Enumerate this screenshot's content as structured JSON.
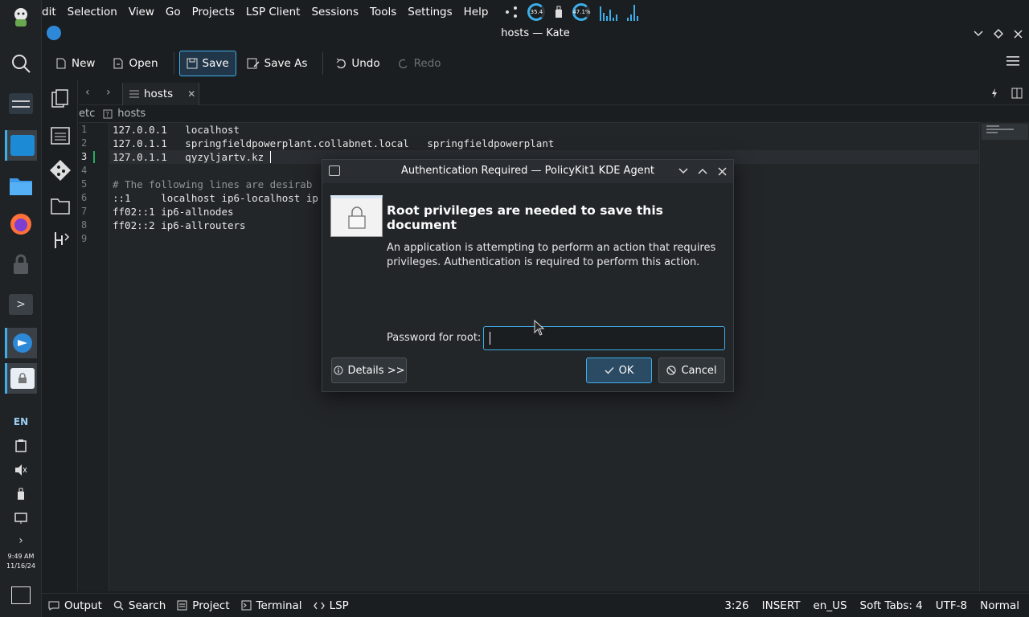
{
  "colors": {
    "accent": "#3daee9",
    "background": "#1b1e20",
    "editor_bg": "#232629",
    "modified_marker": "#27ae60"
  },
  "global_menu": [
    "dit",
    "Selection",
    "View",
    "Go",
    "Projects",
    "LSP Client",
    "Sessions",
    "Tools",
    "Settings",
    "Help"
  ],
  "tray_top": {
    "cpu_gauge": "35.4",
    "mem_gauge": "47.1%"
  },
  "panel": {
    "language": "EN",
    "clock_time": "9:49 AM",
    "clock_date": "11/16/24"
  },
  "window": {
    "title": "hosts — Kate"
  },
  "toolbar": {
    "new": "New",
    "open": "Open",
    "save": "Save",
    "save_as": "Save As",
    "undo": "Undo",
    "redo": "Redo"
  },
  "tab": {
    "name": "hosts"
  },
  "breadcrumb": {
    "dir": "etc",
    "file": "hosts"
  },
  "editor": {
    "lines": [
      "127.0.0.1   localhost",
      "127.0.1.1   springfieldpowerplant.collabnet.local   springfieldpowerplant",
      "127.0.1.1   qyzyljartv.kz",
      "",
      "# The following lines are desirab",
      "::1     localhost ip6-localhost ip",
      "ff02::1 ip6-allnodes",
      "ff02::2 ip6-allrouters",
      ""
    ],
    "line_numbers": [
      "1",
      "2",
      "3",
      "4",
      "5",
      "6",
      "7",
      "8",
      "9"
    ],
    "current_line": 3
  },
  "statusbar": {
    "output": "Output",
    "search": "Search",
    "project": "Project",
    "terminal": "Terminal",
    "lsp": "LSP",
    "position": "3:26",
    "mode": "INSERT",
    "locale": "en_US",
    "tabs": "Soft Tabs: 4",
    "encoding": "UTF-8",
    "input_mode": "Normal"
  },
  "dialog": {
    "title": "Authentication Required — PolicyKit1 KDE Agent",
    "heading": "Root privileges are needed to save this document",
    "body": "An application is attempting to perform an action that requires privileges. Authentication is required to perform this action.",
    "password_label": "Password for root:",
    "password_value": "",
    "details_button": "Details >>",
    "ok_button": "OK",
    "cancel_button": "Cancel"
  }
}
